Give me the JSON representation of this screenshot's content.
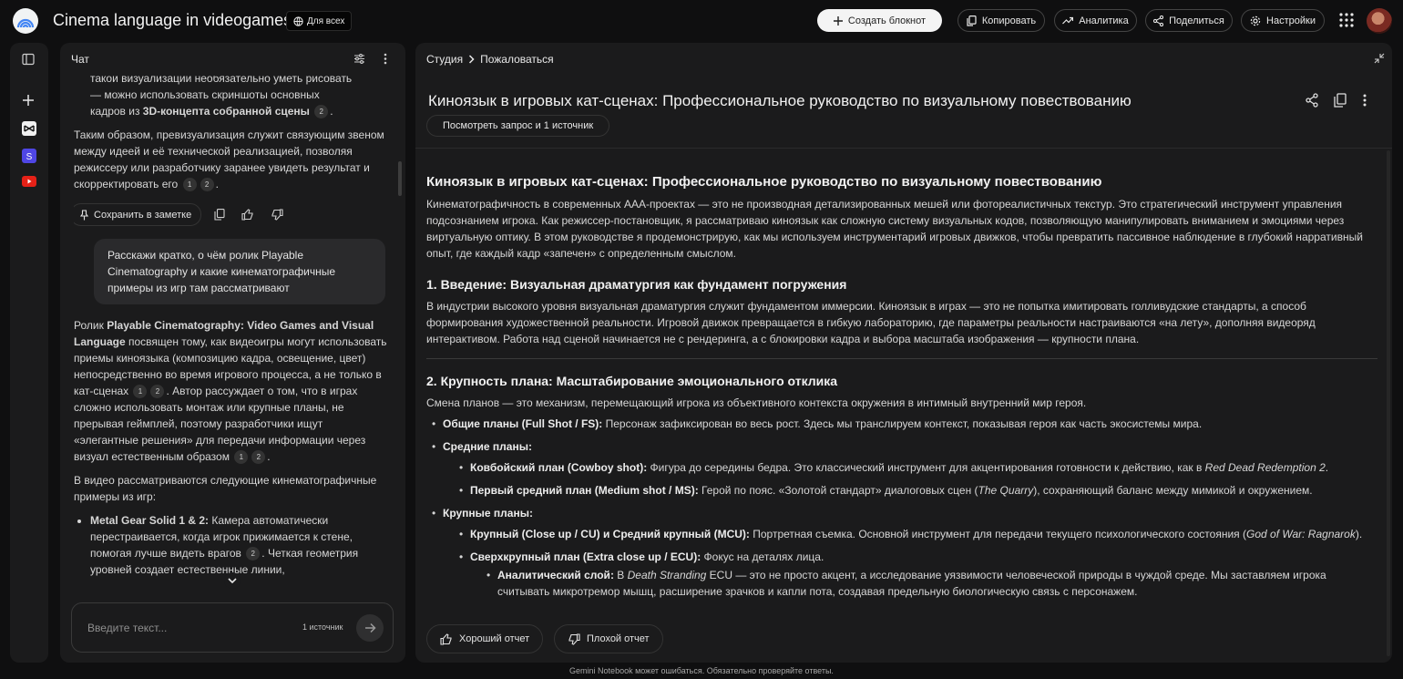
{
  "app": {
    "title": "Cinema language in videogames",
    "share_label": "Для всех"
  },
  "topbar": {
    "create_label": "Создать блокнот",
    "copy_label": "Копировать",
    "analytics_label": "Аналитика",
    "share_label": "Поделиться",
    "settings_label": "Настройки"
  },
  "rail": {
    "icons": [
      "sidebar-toggle-icon",
      "add-icon",
      "capcut-icon",
      "s-icon",
      "youtube-icon"
    ]
  },
  "chat": {
    "label": "Чат",
    "msg1": {
      "l1": "такой визуализации необязательно уметь рисовать",
      "l2": "— можно использовать скриншоты основных",
      "l3a": "кадров из ",
      "l3b": "3D-концепта собранной сцены",
      "c1": "2"
    },
    "msg2": {
      "text": "Таким образом, превизуализация служит связующим звеном между идеей и её технической реализацией, позволяя режиссеру или разработчику заранее увидеть результат и скорректировать его",
      "c1": "1",
      "c2": "2"
    },
    "save_note_label": "Сохранить в заметке",
    "user_message": "Расскажи кратко, о чём ролик Playable Cinematography и какие кинематографичные примеры из игр там рассматривают",
    "answer": {
      "p1a": "Ролик ",
      "p1b": "Playable Cinematography: Video Games and Visual Language",
      "p1c": " посвящен тому, как видеоигры могут использовать приемы киноязыка (композицию кадра, освещение, цвет) непосредственно во время игрового процесса, а не только в кат-сценах",
      "p1d": ". Автор рассуждает о том, что в играх сложно использовать монтаж или крупные планы, не прерывая геймплей, поэтому разработчики ищут «элегантные решения» для передачи информации через визуал естественным образом",
      "c1": "1",
      "c2": "2",
      "c3": "1",
      "c4": "2",
      "p2": "В видео рассматриваются следующие кинематографичные примеры из игр:",
      "li1_title": "Metal Gear Solid 1 & 2:",
      "li1_text": " Камера автоматически перестраивается, когда игрок прижимается к стене, помогая лучше видеть врагов",
      "li1_cite": "2",
      "li1_tail": ". Четкая геометрия уровней создает естественные линии,"
    },
    "input_placeholder": "Введите текст...",
    "sources_count": "1 источник"
  },
  "studio": {
    "crumb_root": "Студия",
    "crumb_current": "Пожаловаться",
    "doc_title": "Киноязык в игровых кат-сценах: Профессиональное руководство по визуальному повествованию",
    "view_query_label": "Посмотреть запрос и 1 источник",
    "doc": {
      "h1": "Киноязык в игровых кат-сценах: Профессиональное руководство по визуальному повествованию",
      "intro": "Кинематографичность в современных AAA-проектах — это не производная детализированных мешей или фотореалистичных текстур. Это стратегический инструмент управления подсознанием игрока. Как режиссер-постановщик, я рассматриваю киноязык как сложную систему визуальных кодов, позволяющую манипулировать вниманием и эмоциями через виртуальную оптику. В этом руководстве я продемонстрирую, как мы используем инструментарий игровых движков, чтобы превратить пассивное наблюдение в глубокий нарративный опыт, где каждый кадр «запечен» с определенным смыслом.",
      "s1_title": "1. Введение: Визуальная драматургия как фундамент погружения",
      "s1_text": "В индустрии высокого уровня визуальная драматургия служит фундаментом иммерсии. Киноязык в играх — это не попытка имитировать голливудские стандарты, а способ формирования художественной реальности. Игровой движок превращается в гибкую лабораторию, где параметры реальности настраиваются «на лету», дополняя видеоряд интерактивом. Работа над сценой начинается не с рендеринга, а с блокировки кадра и выбора масштаба изображения — крупности плана.",
      "s2_title": "2. Крупность плана: Масштабирование эмоционального отклика",
      "s2_text": "Смена планов — это механизм, перемещающий игрока из объективного контекста окружения в интимный внутренний мир героя.",
      "b1_title": "Общие планы (Full Shot / FS):",
      "b1_text": " Персонаж зафиксирован во весь рост. Здесь мы транслируем контекст, показывая героя как часть экосистемы мира.",
      "b2_title": "Средние планы:",
      "b2a_title": "Ковбойский план (Cowboy shot):",
      "b2a_text": " Фигура до середины бедра. Это классический инструмент для акцентирования готовности к действию, как в ",
      "b2a_game": "Red Dead Redemption 2",
      "b2b_title": "Первый средний план (Medium shot / MS):",
      "b2b_text": " Герой по пояс. «Золотой стандарт» диалоговых сцен (",
      "b2b_game": "The Quarry",
      "b2b_tail": "), сохраняющий баланс между мимикой и окружением.",
      "b3_title": "Крупные планы:",
      "b3a_title": "Крупный (Close up / CU) и Средний крупный (MCU):",
      "b3a_text": " Портретная съемка. Основной инструмент для передачи текущего психологического состояния (",
      "b3a_game": "God of War: Ragnarok",
      "b3a_tail": ").",
      "b3b_title": "Сверхкрупный план (Extra close up / ECU):",
      "b3b_text": " Фокус на деталях лица.",
      "b3c_title": "Аналитический слой:",
      "b3c_pre": " В ",
      "b3c_game": "Death Stranding",
      "b3c_text": " ECU — это не просто акцент, а исследование уязвимости человеческой природы в чуждой среде. Мы заставляем игрока считывать микротремор мышц, расширение зрачков и капли пота, создавая предельную биологическую связь с персонажем."
    },
    "good_report_label": "Хороший отчет",
    "bad_report_label": "Плохой отчет"
  },
  "footer": "Gemini Notebook может ошибаться. Обязательно проверяйте ответы."
}
